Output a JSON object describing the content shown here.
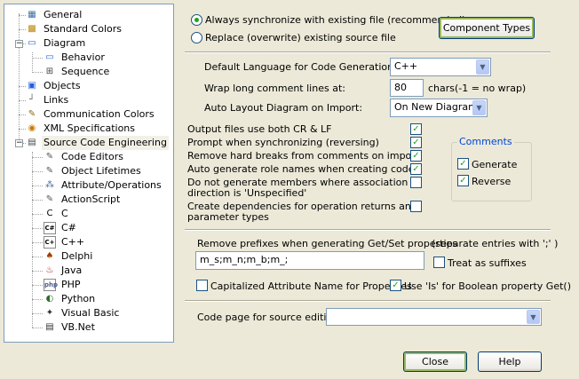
{
  "tree": {
    "items": [
      {
        "label": "General",
        "icon": "general-icon"
      },
      {
        "label": "Standard Colors",
        "icon": "colors-icon"
      },
      {
        "label": "Diagram",
        "icon": "diagram-icon",
        "expander": "minus"
      },
      {
        "label": "Behavior",
        "icon": "behavior-icon"
      },
      {
        "label": "Sequence",
        "icon": "sequence-icon"
      },
      {
        "label": "Objects",
        "icon": "objects-icon"
      },
      {
        "label": "Links",
        "icon": "links-icon"
      },
      {
        "label": "Communication Colors",
        "icon": "communication-icon"
      },
      {
        "label": "XML Specifications",
        "icon": "xml-icon"
      },
      {
        "label": "Source Code Engineering",
        "icon": "source-code-icon",
        "expander": "minus",
        "selected": true
      },
      {
        "label": "Code Editors",
        "icon": "code-editor-icon"
      },
      {
        "label": "Object Lifetimes",
        "icon": "lifetime-icon"
      },
      {
        "label": "Attribute/Operations",
        "icon": "attribute-icon"
      },
      {
        "label": "ActionScript",
        "icon": "actionscript-icon"
      },
      {
        "label": "C",
        "icon": "c-icon",
        "glyph": "C"
      },
      {
        "label": "C#",
        "icon": "csharp-icon",
        "glyph": "C#"
      },
      {
        "label": "C++",
        "icon": "cpp-icon",
        "glyph": "C+"
      },
      {
        "label": "Delphi",
        "icon": "delphi-icon"
      },
      {
        "label": "Java",
        "icon": "java-icon"
      },
      {
        "label": "PHP",
        "icon": "php-icon",
        "glyph": "php"
      },
      {
        "label": "Python",
        "icon": "python-icon"
      },
      {
        "label": "Visual Basic",
        "icon": "visual-basic-icon"
      },
      {
        "label": "VB.Net",
        "icon": "vbnet-icon"
      }
    ]
  },
  "sync": {
    "always_label": "Always synchronize with existing file (recommended)",
    "always_selected": true,
    "replace_label": "Replace (overwrite) existing source file",
    "replace_selected": false
  },
  "component_types_label": "Component Types",
  "language": {
    "label": "Default Language for Code Generation:",
    "value": "C++"
  },
  "wrap": {
    "label": "Wrap long comment lines at:",
    "value": "80",
    "hint": "chars(-1 = no wrap)"
  },
  "auto_layout": {
    "label": "Auto Layout Diagram on Import:",
    "value": "On New Diagram"
  },
  "options": [
    {
      "label": "Output files use both CR & LF",
      "checked": true
    },
    {
      "label": "Prompt when synchronizing (reversing)",
      "checked": true
    },
    {
      "label": "Remove hard breaks from  comments on import",
      "checked": true
    },
    {
      "label": "Auto generate role names when creating code",
      "checked": true
    },
    {
      "label_line1": "Do not generate members where association",
      "label_line2": "direction is 'Unspecified'",
      "checked": false
    },
    {
      "label_line1": "Create dependencies for operation returns and",
      "label_line2": "parameter types",
      "checked": false
    }
  ],
  "comments": {
    "title": "Comments",
    "generate_label": "Generate",
    "generate_checked": true,
    "reverse_label": "Reverse",
    "reverse_checked": true
  },
  "prefixes": {
    "label": "Remove prefixes when generating Get/Set properties",
    "hint": "(separate entries with ';' )",
    "value": "m_s;m_n;m_b;m_;",
    "suffix_label": "Treat as suffixes",
    "suffix_checked": false
  },
  "capitalized": {
    "label": "Capitalized Attribute Name for Properties",
    "checked": false
  },
  "is_bool": {
    "label": "Use 'Is' for Boolean property Get()",
    "checked": true
  },
  "codepage": {
    "label": "Code page for source editing:",
    "value": ""
  },
  "buttons": {
    "close": "Close",
    "help": "Help"
  },
  "colors": {
    "dialog_bg": "#ECE9D8",
    "check_green": "#21A121",
    "group_title": "#0046D5"
  }
}
